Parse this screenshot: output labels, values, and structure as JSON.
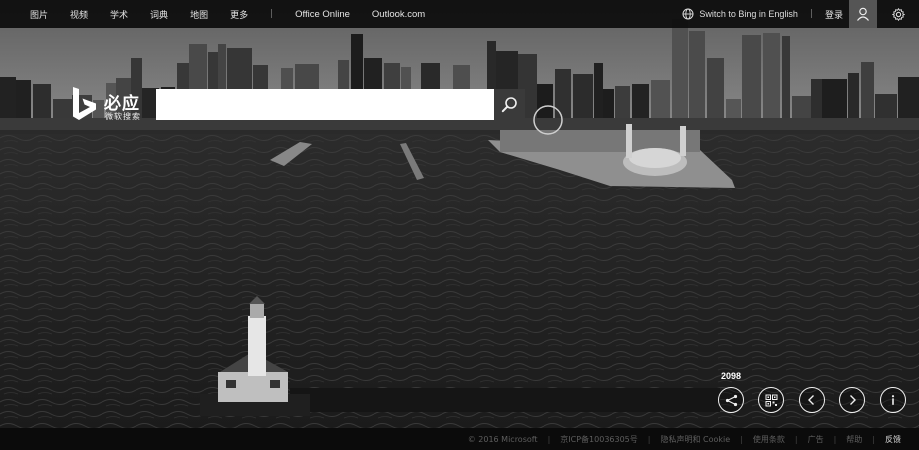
{
  "nav": {
    "items": [
      {
        "label": "图片"
      },
      {
        "label": "视频"
      },
      {
        "label": "学术"
      },
      {
        "label": "词典"
      },
      {
        "label": "地图"
      },
      {
        "label": "更多"
      }
    ],
    "separator": "|",
    "external": [
      {
        "label": "Office Online"
      },
      {
        "label": "Outlook.com"
      }
    ]
  },
  "header_right": {
    "switch_language": "Switch to Bing in English",
    "separator": "|",
    "sign_in": "登录",
    "globe_icon": "globe-icon",
    "user_icon": "user-icon",
    "settings_icon": "gear-icon"
  },
  "logo": {
    "word": "必应",
    "sub": "微软搜索",
    "mark_icon": "bing-logo-icon"
  },
  "search": {
    "value": "",
    "placeholder": "",
    "button_icon": "search-icon"
  },
  "image_controls": {
    "share_count": "2098",
    "buttons": [
      {
        "icon": "share-icon"
      },
      {
        "icon": "qr-code-icon"
      },
      {
        "icon": "chevron-left-icon"
      },
      {
        "icon": "chevron-right-icon"
      },
      {
        "icon": "info-icon"
      }
    ]
  },
  "footer": {
    "items": [
      {
        "label": "© 2016 Microsoft"
      },
      {
        "label": "京ICP备10036305号"
      },
      {
        "label": "隐私声明和 Cookie"
      },
      {
        "label": "使用条款"
      },
      {
        "label": "广告"
      },
      {
        "label": "帮助"
      }
    ],
    "separator": "|",
    "feedback": "反馈"
  },
  "colors": {
    "topbar": "#0a0a0a",
    "search_box": "#ffffff",
    "search_button": "#3a3a3a",
    "avatar_bg": "#555555",
    "footer_text": "#5e5e5e",
    "footer_feedback": "#d8d8d8"
  }
}
